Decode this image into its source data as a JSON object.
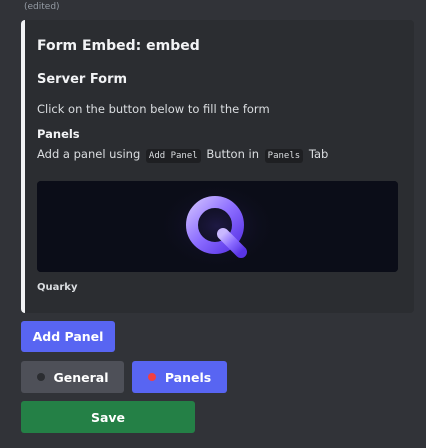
{
  "message": {
    "edited_label": "(edited)"
  },
  "embed": {
    "title": "Form Embed: embed",
    "subtitle": "Server Form",
    "description": "Click on the button below to fill the form",
    "field": {
      "name": "Panels",
      "value_prefix": "Add a panel using",
      "value_code_1": "Add Panel",
      "value_middle": "Button in",
      "value_code_2": "Panels",
      "value_suffix": "Tab"
    },
    "footer": "Quarky",
    "image_icon": "quarky-logo-q",
    "border_color": "#f2f3f5"
  },
  "buttons": {
    "add_panel": {
      "label": "Add Panel",
      "color": "#5865f2"
    },
    "general": {
      "label": "General",
      "icon": "dark-circle-icon",
      "color": "#4e5058"
    },
    "panels": {
      "label": "Panels",
      "icon": "red-circle-icon",
      "color": "#5865f2"
    },
    "save": {
      "label": "Save",
      "color": "#248046"
    }
  }
}
